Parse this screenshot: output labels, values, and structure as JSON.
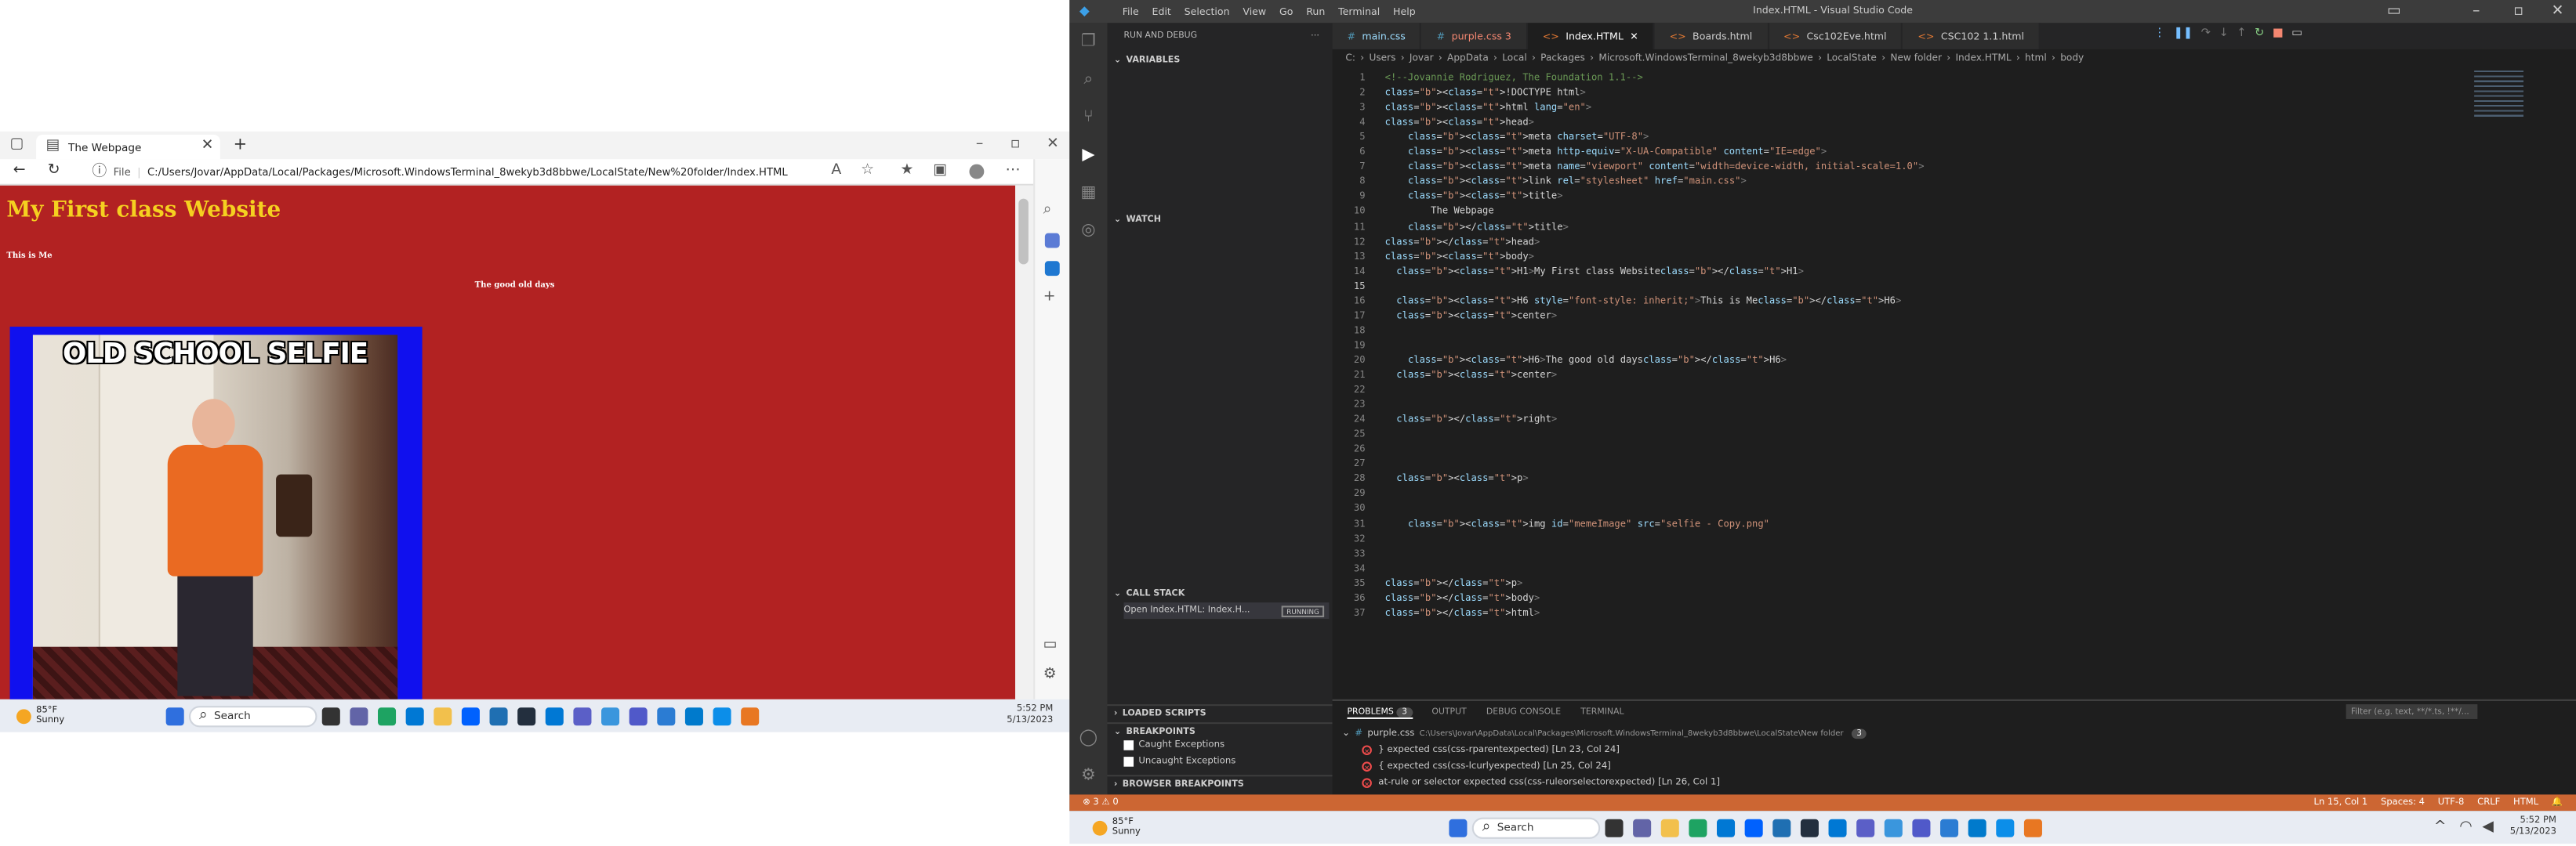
{
  "browser": {
    "tab_title": "The Webpage",
    "new_tab": "+",
    "url_prefix": "File",
    "url": "C:/Users/Jovar/AppData/Local/Packages/Microsoft.WindowsTerminal_8wekyb3d8bbwe/LocalState/New%20folder/Index.HTML",
    "page": {
      "h1": "My First class Website",
      "h6_left": "This is Me",
      "h6_center": "The good old days",
      "meme_caption": "OLD SCHOOL SELFIE"
    }
  },
  "taskbar": {
    "temp": "85°F",
    "weather": "Sunny",
    "search": "Search",
    "time": "5:52 PM",
    "date": "5/13/2023"
  },
  "vscode": {
    "window_title": "Index.HTML - Visual Studio Code",
    "menu": [
      "File",
      "Edit",
      "Selection",
      "View",
      "Go",
      "Run",
      "Terminal",
      "Help"
    ],
    "sidebar": {
      "header": "RUN AND DEBUG",
      "variables": "VARIABLES",
      "watch": "WATCH",
      "call_stack": "CALL STACK",
      "call_item": "Open Index.HTML: Index.H...",
      "running": "RUNNING",
      "loaded_scripts": "LOADED SCRIPTS",
      "breakpoints": "BREAKPOINTS",
      "caught": "Caught Exceptions",
      "uncaught": "Uncaught Exceptions",
      "browser_breakpoints": "BROWSER BREAKPOINTS"
    },
    "tabs": [
      {
        "label": "main.css",
        "color": "#9cdcfe"
      },
      {
        "label": "purple.css 3",
        "color": "#f48771"
      },
      {
        "label": "Index.HTML",
        "color": "#ffffff"
      },
      {
        "label": "Boards.html",
        "color": "#cccccc"
      },
      {
        "label": "Csc102Eve.html",
        "color": "#cccccc"
      },
      {
        "label": "CSC102 1.1.html",
        "color": "#cccccc"
      }
    ],
    "breadcrumb": [
      "C:",
      "Users",
      "Jovar",
      "AppData",
      "Local",
      "Packages",
      "Microsoft.WindowsTerminal_8wekyb3d8bbwe",
      "LocalState",
      "New folder",
      "Index.HTML",
      "html",
      "body"
    ],
    "code_lines": [
      "<!--Jovannie Rodriguez, The Foundation 1.1-->",
      "<!DOCTYPE html>",
      "<html lang=\"en\">",
      "<head>",
      "    <meta charset=\"UTF-8\">",
      "    <meta http-equiv=\"X-UA-Compatible\" content=\"IE=edge\">",
      "    <meta name=\"viewport\" content=\"width=device-width, initial-scale=1.0\">",
      "    <link rel=\"stylesheet\" href=\"main.css\">",
      "    <title>",
      "        The Webpage",
      "    </title>",
      "</head>",
      "<body>",
      "  <H1>My First class Website</H1>",
      "",
      "  <H6 style=\"font-style: inherit;\">This is Me</H6>",
      "  <center>",
      "",
      "",
      "    <H6>The good old days</H6>",
      "  <center>",
      "",
      "",
      "  </right>",
      "",
      "",
      "",
      "  <p>",
      "",
      "",
      "    <img id=\"memeImage\" src=\"selfie - Copy.png\"",
      "",
      "",
      "",
      "</p>",
      "</body>",
      "</html>"
    ],
    "panel": {
      "tabs": [
        "PROBLEMS",
        "OUTPUT",
        "DEBUG CONSOLE",
        "TERMINAL"
      ],
      "problem_count": "3",
      "file": "purple.css",
      "path": "C:\\Users\\Jovar\\AppData\\Local\\Packages\\Microsoft.WindowsTerminal_8wekyb3d8bbwe\\LocalState\\New folder",
      "problems": [
        "} expected  css(css-rparentexpected)  [Ln 23, Col 24]",
        "{ expected  css(css-lcurlyexpected)  [Ln 25, Col 24]",
        "at-rule or selector expected  css(css-ruleorselectorexpected)  [Ln 26, Col 1]"
      ],
      "filter": "Filter (e.g. text, **/*.ts, !**/..."
    },
    "status": {
      "errors": "⊗ 3  ⚠ 0",
      "position": "Ln 15, Col 1",
      "spaces": "Spaces: 4",
      "encoding": "UTF-8",
      "eol": "CRLF",
      "language": "HTML"
    }
  }
}
